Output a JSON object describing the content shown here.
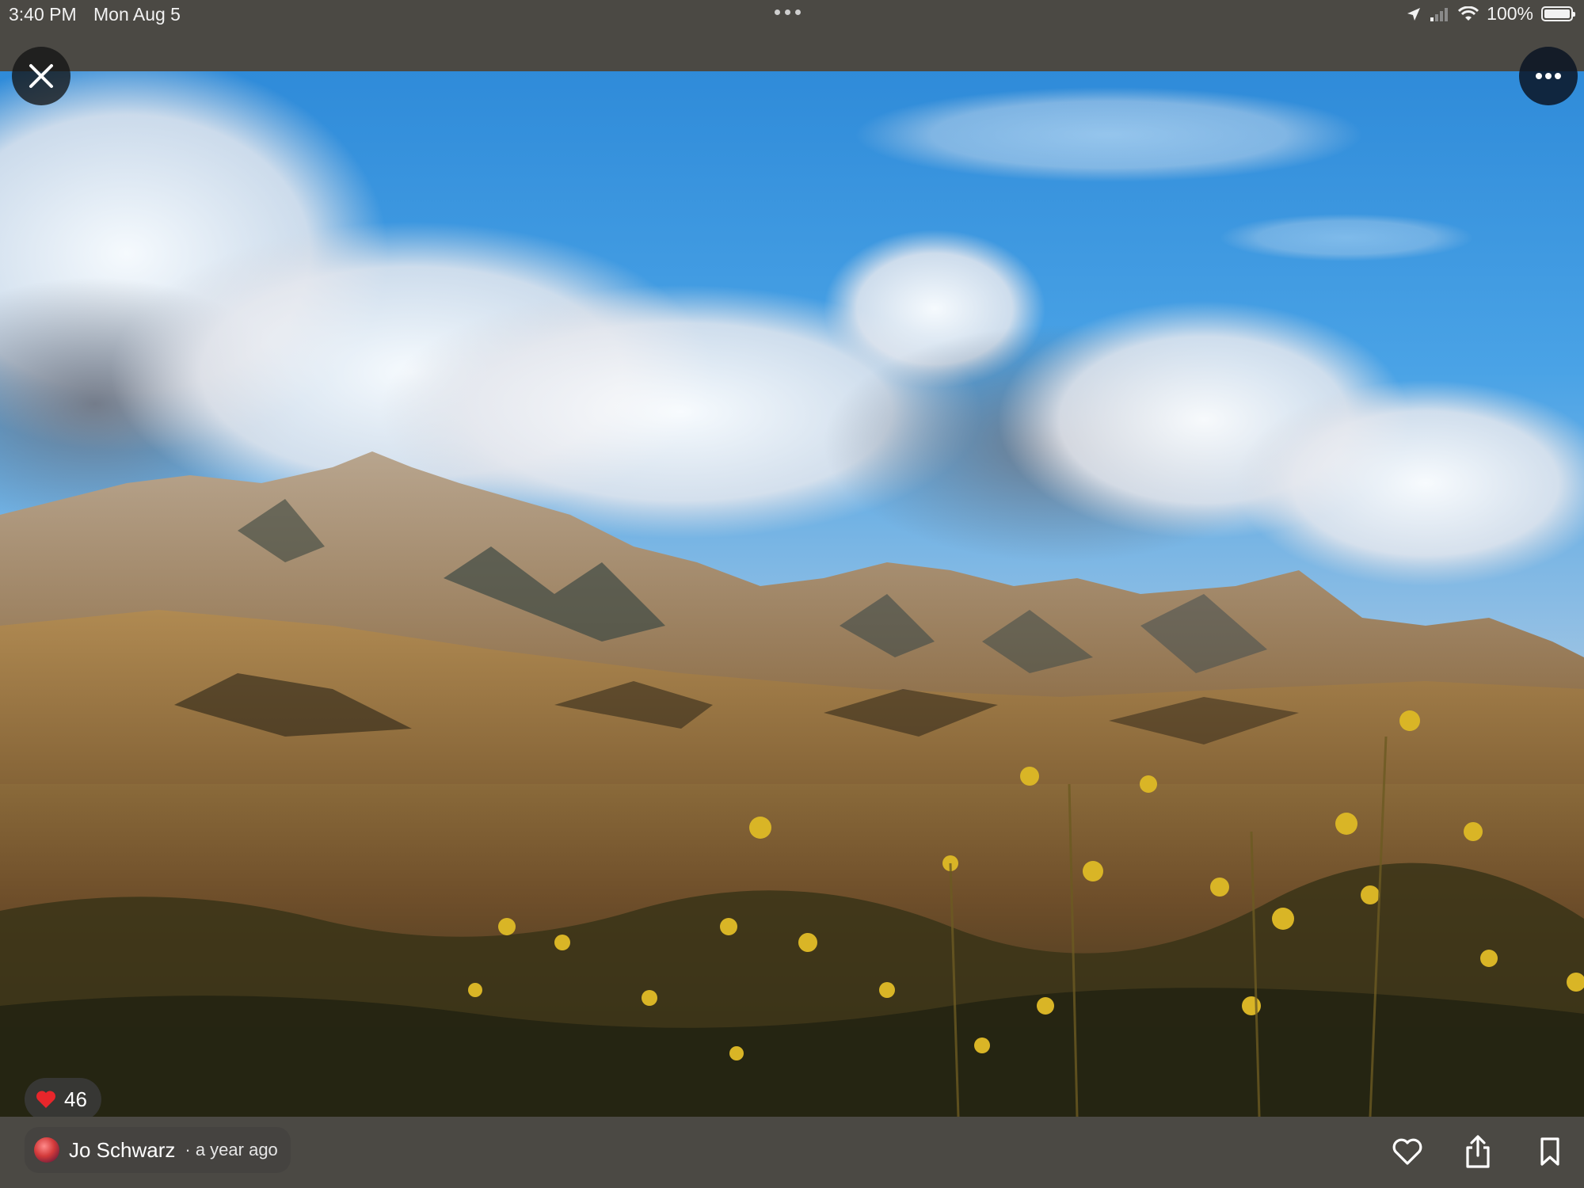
{
  "status_bar": {
    "time": "3:40 PM",
    "date": "Mon Aug 5",
    "battery": "100%"
  },
  "photo": {
    "description_icon": "landscape-photo"
  },
  "toolbar": {
    "close_icon": "close-icon",
    "more_icon": "more-icon"
  },
  "likes": {
    "count": "46",
    "icon": "heart-filled-icon",
    "color": "#e8262b"
  },
  "author": {
    "name": "Jo Schwarz",
    "time": "· a year ago"
  },
  "actions": {
    "like_icon": "heart-outline-icon",
    "share_icon": "share-icon",
    "save_icon": "bookmark-icon"
  }
}
